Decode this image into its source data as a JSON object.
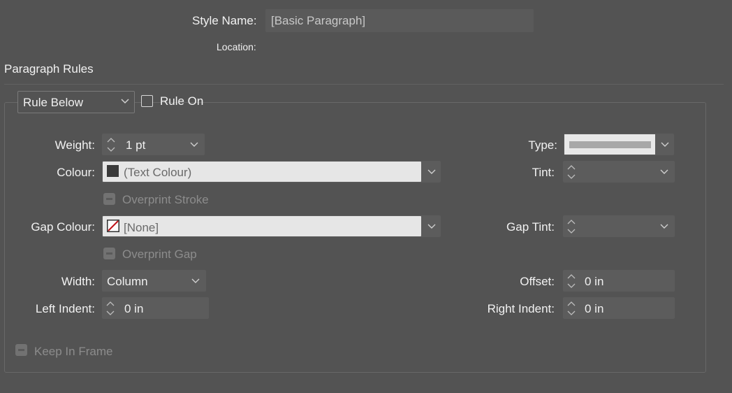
{
  "style_name": {
    "label": "Style Name:",
    "value": "[Basic Paragraph]"
  },
  "location": {
    "label": "Location:"
  },
  "section_title": "Paragraph Rules",
  "rule_select": {
    "value": "Rule Below"
  },
  "rule_on": {
    "label": "Rule On",
    "checked": false
  },
  "weight": {
    "label": "Weight:",
    "value": "1 pt"
  },
  "type": {
    "label": "Type:"
  },
  "colour": {
    "label": "Colour:",
    "value": "(Text Colour)",
    "swatch": "#3a3a3a"
  },
  "tint": {
    "label": "Tint:",
    "value": ""
  },
  "overprint_stroke": {
    "label": "Overprint Stroke",
    "enabled": false
  },
  "gap_colour": {
    "label": "Gap Colour:",
    "value": "[None]"
  },
  "gap_tint": {
    "label": "Gap Tint:",
    "value": ""
  },
  "overprint_gap": {
    "label": "Overprint Gap",
    "enabled": false
  },
  "width": {
    "label": "Width:",
    "value": "Column"
  },
  "offset": {
    "label": "Offset:",
    "value": "0 in"
  },
  "left_indent": {
    "label": "Left Indent:",
    "value": "0 in"
  },
  "right_indent": {
    "label": "Right Indent:",
    "value": "0 in"
  },
  "keep_in_frame": {
    "label": "Keep In Frame",
    "enabled": false
  },
  "colors": {
    "panel_bg": "#535353",
    "field_dark": "#5c5c5c",
    "field_light": "#e6e6e6",
    "none_red": "#c0161c"
  }
}
